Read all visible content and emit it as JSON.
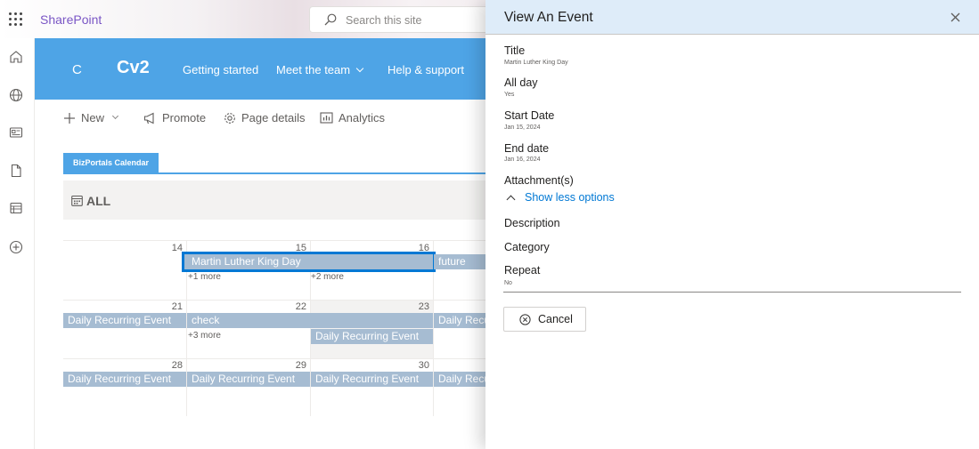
{
  "app": {
    "brand": "SharePoint",
    "search_placeholder": "Search this site"
  },
  "site": {
    "logo_letter": "C",
    "title": "Cv2",
    "nav": [
      "Getting started",
      "Meet the team",
      "Help & support"
    ]
  },
  "commands": [
    "New",
    "Promote",
    "Page details",
    "Analytics"
  ],
  "calendar": {
    "tab": "BizPortals Calendar",
    "view_label": "ALL",
    "weeks": [
      {
        "days": [
          "14",
          "15",
          "16"
        ],
        "events": [
          {
            "label": "Martin Luther King Day",
            "selected": true
          },
          {
            "label": "future"
          }
        ],
        "more": [
          "+1 more",
          "+2 more"
        ]
      },
      {
        "days": [
          "21",
          "22",
          "23"
        ],
        "events": [
          {
            "label": "Daily Recurring Event"
          },
          {
            "label": "check"
          },
          {
            "label": "Daily Recurring Event"
          },
          {
            "label": "Daily Recurring Event"
          }
        ],
        "more": [
          "+3 more"
        ]
      },
      {
        "days": [
          "28",
          "29",
          "30"
        ],
        "events": [
          {
            "label": "Daily Recurring Event"
          },
          {
            "label": "Daily Recurring Event"
          },
          {
            "label": "Daily Recurring Event"
          },
          {
            "label": "Daily Recurring Event"
          }
        ]
      }
    ]
  },
  "panel": {
    "title": "View An Event",
    "fields": [
      {
        "label": "Title",
        "value": "Martin Luther King Day"
      },
      {
        "label": "All day",
        "value": "Yes"
      },
      {
        "label": "Start Date",
        "value": "Jan 15, 2024"
      },
      {
        "label": "End date",
        "value": "Jan 16, 2024"
      },
      {
        "label": "Attachment(s)",
        "value": ""
      }
    ],
    "show_less": "Show less options",
    "extra_fields": [
      {
        "label": "Description"
      },
      {
        "label": "Category"
      },
      {
        "label": "Repeat",
        "value": "No"
      }
    ],
    "cancel_label": "Cancel"
  },
  "colors": {
    "accent": "#0078d4",
    "header": "#4ea4e6",
    "event": "#a6bcd2",
    "brand": "#7a56c5"
  },
  "icons": [
    "waffle-icon",
    "search-icon",
    "home-icon",
    "globe-icon",
    "news-icon",
    "document-icon",
    "list-icon",
    "add-circle-icon",
    "plus-icon",
    "megaphone-icon",
    "gear-icon",
    "analytics-icon",
    "calendar-icon",
    "close-icon",
    "chevron-up-icon",
    "cancel-icon"
  ]
}
